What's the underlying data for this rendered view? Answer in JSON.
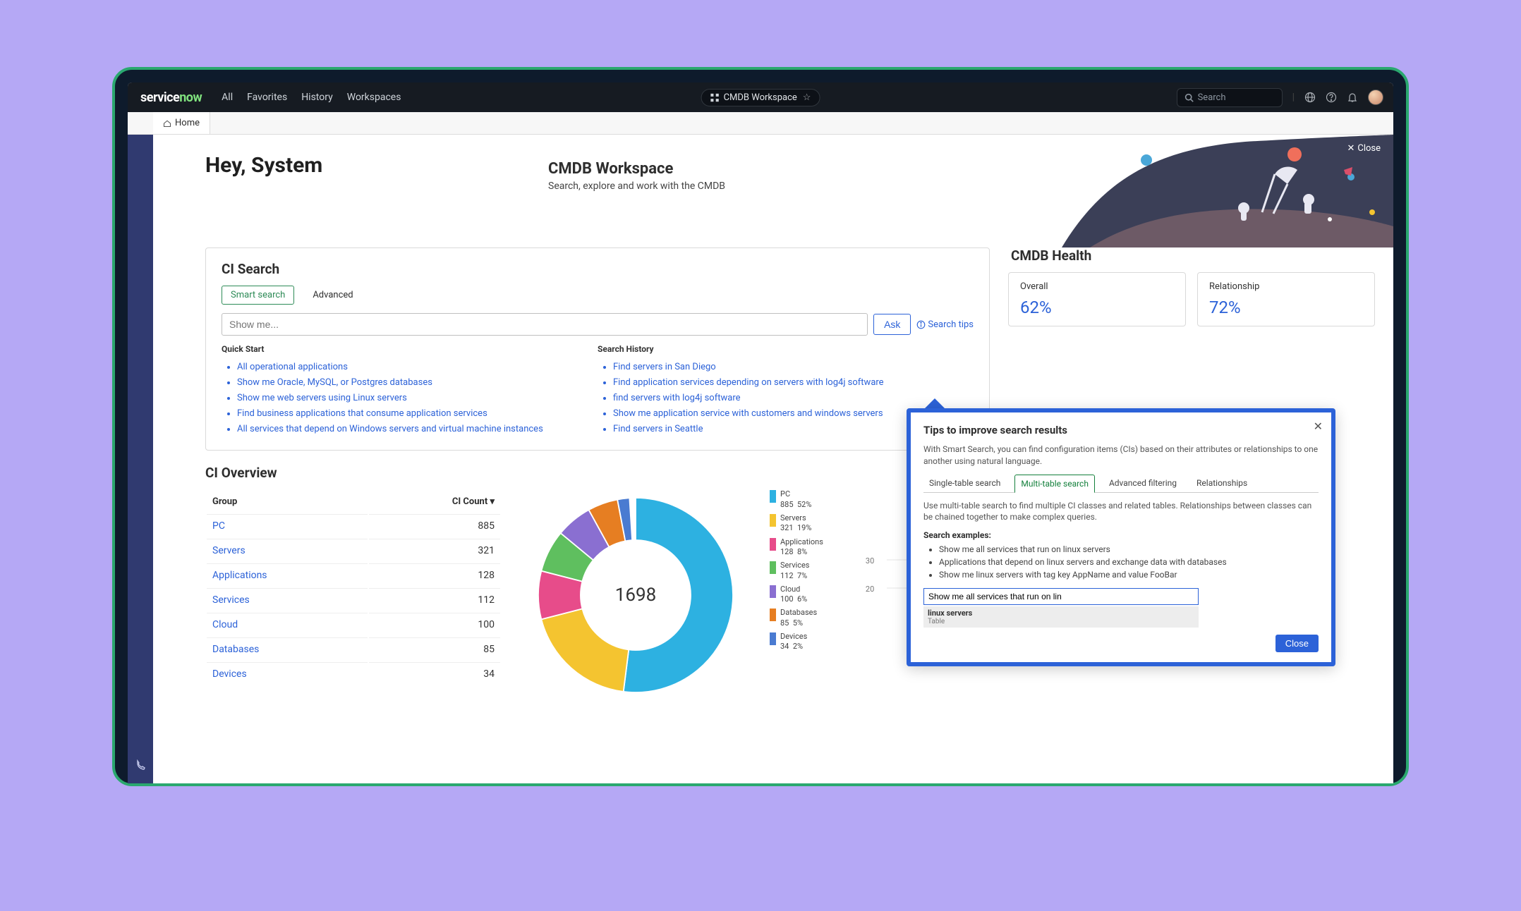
{
  "topnav": {
    "logo_main": "service",
    "logo_accent": "now",
    "items": [
      "All",
      "Favorites",
      "History",
      "Workspaces"
    ],
    "crumb_label": "CMDB Workspace",
    "search_placeholder": "Search"
  },
  "tabs_top": {
    "home": "Home"
  },
  "hero": {
    "greeting": "Hey, System",
    "title": "CMDB Workspace",
    "subtitle": "Search, explore and work with the CMDB",
    "close": "Close"
  },
  "ci_search": {
    "heading": "CI Search",
    "tab_smart": "Smart search",
    "tab_advanced": "Advanced",
    "placeholder": "Show me...",
    "ask": "Ask",
    "tips": "Search tips",
    "quick_start_label": "Quick Start",
    "history_label": "Search History",
    "quick_start": [
      "All operational applications",
      "Show me Oracle, MySQL, or Postgres databases",
      "Show me web servers using Linux servers",
      "Find business applications that consume application services",
      "All services that depend on Windows servers and virtual machine instances"
    ],
    "history": [
      "Find servers in San Diego",
      "Find application services depending on servers with log4j software",
      "find servers with log4j software",
      "Show me application service with customers and windows servers",
      "Find servers in Seattle"
    ]
  },
  "health": {
    "heading": "CMDB Health",
    "overall_label": "Overall",
    "overall_value": "62%",
    "relationship_label": "Relationship",
    "relationship_value": "72%"
  },
  "overview": {
    "heading": "CI Overview",
    "col_group": "Group",
    "col_count": "CI Count",
    "rows": [
      {
        "name": "PC",
        "count": "885"
      },
      {
        "name": "Servers",
        "count": "321"
      },
      {
        "name": "Applications",
        "count": "128"
      },
      {
        "name": "Services",
        "count": "112"
      },
      {
        "name": "Cloud",
        "count": "100"
      },
      {
        "name": "Databases",
        "count": "85"
      },
      {
        "name": "Devices",
        "count": "34"
      }
    ],
    "donut_total": "1698",
    "legend": [
      {
        "name": "PC",
        "count": "885",
        "pct": "52%",
        "color": "#2db1e1"
      },
      {
        "name": "Servers",
        "count": "321",
        "pct": "19%",
        "color": "#f4c430"
      },
      {
        "name": "Applications",
        "count": "128",
        "pct": "8%",
        "color": "#e74c8a"
      },
      {
        "name": "Services",
        "count": "112",
        "pct": "7%",
        "color": "#5fbf5f"
      },
      {
        "name": "Cloud",
        "count": "100",
        "pct": "6%",
        "color": "#8a6fd1"
      },
      {
        "name": "Databases",
        "count": "85",
        "pct": "5%",
        "color": "#e67e22"
      },
      {
        "name": "Devices",
        "count": "34",
        "pct": "2%",
        "color": "#4a7bd1"
      }
    ],
    "side_y": [
      "30",
      "20"
    ]
  },
  "tips_modal": {
    "title": "Tips to improve search results",
    "desc": "With Smart Search, you can find configuration items (CIs) based on their attributes or relationships to one another using natural language.",
    "tabs": [
      "Single-table search",
      "Multi-table search",
      "Advanced filtering",
      "Relationships"
    ],
    "active_tab_text": "Use multi-table search to find multiple CI classes and related tables. Relationships between classes can be chained together to make complex queries.",
    "examples_label": "Search examples:",
    "examples": [
      "Show me all services that run on linux servers",
      "Applications that depend on linux servers and exchange data with databases",
      "Show me linux servers with tag key AppName and value FooBar"
    ],
    "example_input": "Show me all services that run on lin",
    "suggest_main": "linux servers",
    "suggest_sub": "Table",
    "close": "Close"
  },
  "chart_data": {
    "type": "pie",
    "title": "CI Overview",
    "total": 1698,
    "series": [
      {
        "name": "PC",
        "value": 885,
        "pct": 52,
        "color": "#2db1e1"
      },
      {
        "name": "Servers",
        "value": 321,
        "pct": 19,
        "color": "#f4c430"
      },
      {
        "name": "Applications",
        "value": 128,
        "pct": 8,
        "color": "#e74c8a"
      },
      {
        "name": "Services",
        "value": 112,
        "pct": 7,
        "color": "#5fbf5f"
      },
      {
        "name": "Cloud",
        "value": 100,
        "pct": 6,
        "color": "#8a6fd1"
      },
      {
        "name": "Databases",
        "value": 85,
        "pct": 5,
        "color": "#e67e22"
      },
      {
        "name": "Devices",
        "value": 34,
        "pct": 2,
        "color": "#4a7bd1"
      }
    ]
  }
}
